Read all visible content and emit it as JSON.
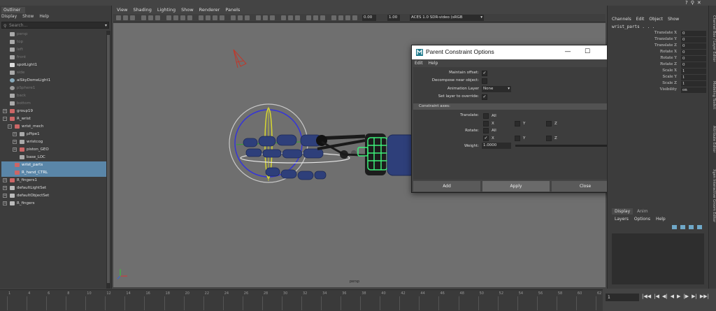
{
  "window_controls": [
    "?",
    "⚲",
    "✕"
  ],
  "outliner": {
    "tab": "Outliner",
    "menu": [
      "Display",
      "Show",
      "Help"
    ],
    "search_placeholder": "Search...",
    "items": [
      {
        "label": "persp",
        "indent": 0,
        "icon": "camera-icon",
        "dim": true
      },
      {
        "label": "top",
        "indent": 0,
        "icon": "camera-icon",
        "dim": true
      },
      {
        "label": "left",
        "indent": 0,
        "icon": "camera-icon",
        "dim": true
      },
      {
        "label": "front",
        "indent": 0,
        "icon": "camera-icon",
        "dim": true
      },
      {
        "label": "spotLight1",
        "indent": 0,
        "icon": "spotlight-icon",
        "dim": false
      },
      {
        "label": "side",
        "indent": 0,
        "icon": "camera-icon",
        "dim": true
      },
      {
        "label": "aiSkyDomeLight1",
        "indent": 0,
        "icon": "skydome-icon",
        "dim": false
      },
      {
        "label": "pSphere1",
        "indent": 0,
        "icon": "sphere-icon",
        "dim": true
      },
      {
        "label": "back",
        "indent": 0,
        "icon": "camera-icon",
        "dim": true
      },
      {
        "label": "bottom",
        "indent": 0,
        "icon": "camera-icon",
        "dim": true
      },
      {
        "label": "group19",
        "indent": 0,
        "icon": "group-icon",
        "dim": false,
        "expander": "+"
      },
      {
        "label": "R_wrist",
        "indent": 0,
        "icon": "group-icon",
        "dim": false,
        "expander": "−"
      },
      {
        "label": "wrist_mech",
        "indent": 1,
        "icon": "group-icon",
        "dim": false,
        "expander": "−"
      },
      {
        "label": "pPipe1",
        "indent": 2,
        "icon": "locator-icon",
        "dim": false,
        "expander": "+"
      },
      {
        "label": "wristcog",
        "indent": 2,
        "icon": "locator-icon",
        "dim": false,
        "expander": "+"
      },
      {
        "label": "piston_GEO",
        "indent": 2,
        "icon": "group-icon",
        "dim": false,
        "expander": "+"
      },
      {
        "label": "base_LOC",
        "indent": 2,
        "icon": "locator-icon",
        "dim": false
      },
      {
        "label": "wrist_parts",
        "indent": 1,
        "icon": "group-icon",
        "dim": false,
        "selected": true
      },
      {
        "label": "R_hand_CTRL",
        "indent": 1,
        "icon": "curve-icon",
        "dim": false,
        "selected": true
      },
      {
        "label": "R_fingers1",
        "indent": 0,
        "icon": "group-icon",
        "dim": false,
        "expander": "+"
      },
      {
        "label": "defaultLightSet",
        "indent": 0,
        "icon": "set-icon",
        "dim": false,
        "expander": "+"
      },
      {
        "label": "defaultObjectSet",
        "indent": 0,
        "icon": "set-icon",
        "dim": false,
        "expander": "+"
      },
      {
        "label": "R_fingers",
        "indent": 0,
        "icon": "set-icon",
        "dim": false,
        "expander": "+"
      }
    ]
  },
  "viewport": {
    "menu": [
      "View",
      "Shading",
      "Lighting",
      "Show",
      "Renderer",
      "Panels"
    ],
    "exposure": "0.00",
    "gamma": "1.00",
    "color_space": "ACES 1.0 SDR-video (sRGB",
    "camera_label": "persp"
  },
  "channel_box": {
    "menu": [
      "Channels",
      "Edit",
      "Object",
      "Show"
    ],
    "object_name": "wrist_parts",
    "attributes": [
      {
        "name": "Translate X",
        "value": "0"
      },
      {
        "name": "Translate Y",
        "value": "0"
      },
      {
        "name": "Translate Z",
        "value": "0"
      },
      {
        "name": "Rotate X",
        "value": "0"
      },
      {
        "name": "Rotate Y",
        "value": "0"
      },
      {
        "name": "Rotate Z",
        "value": "0"
      },
      {
        "name": "Scale X",
        "value": "1"
      },
      {
        "name": "Scale Y",
        "value": "1"
      },
      {
        "name": "Scale Z",
        "value": "1"
      },
      {
        "name": "Visibility",
        "value": "on"
      }
    ],
    "side_tabs": [
      "Channel Box / Layer Editor",
      "Modeling Toolkit",
      "Attribute Editor",
      "Xgen Interactive Groom Editor"
    ]
  },
  "display_layers": {
    "tabs": [
      "Display",
      "Anim"
    ],
    "menu": [
      "Layers",
      "Options",
      "Help"
    ]
  },
  "timeline": {
    "ticks": [
      "1",
      "4",
      "6",
      "8",
      "10",
      "12",
      "14",
      "16",
      "18",
      "20",
      "22",
      "24",
      "26",
      "28",
      "30",
      "32",
      "34",
      "36",
      "38",
      "40",
      "42",
      "44",
      "46",
      "48",
      "50",
      "52",
      "54",
      "56",
      "58",
      "60",
      "62"
    ],
    "current_frame": "1",
    "controls": [
      "|◀◀",
      "|◀",
      "◀|",
      "◀",
      "▶",
      "|▶",
      "▶|",
      "▶▶|"
    ]
  },
  "dialog": {
    "title": "Parent Constraint Options",
    "window_buttons": [
      "—",
      "☐",
      "✕"
    ],
    "menu": [
      "Edit",
      "Help"
    ],
    "maintain_offset_label": "Maintain offset:",
    "maintain_offset_check": "✓",
    "decompose_label": "Decompose near object:",
    "animation_layer_label": "Animation Layer",
    "animation_layer_value": "None",
    "set_layer_label": "Set layer to override:",
    "set_layer_check": "✓",
    "section_title": "Constraint axes:",
    "translate_label": "Translate:",
    "rotate_label": "Rotate:",
    "axis_all": "All",
    "axis_x": "X",
    "axis_y": "Y",
    "axis_z": "Z",
    "rotate_x_check": "✓",
    "weight_label": "Weight:",
    "weight_value": "1.0000",
    "buttons": {
      "add": "Add",
      "apply": "Apply",
      "close": "Close"
    }
  }
}
